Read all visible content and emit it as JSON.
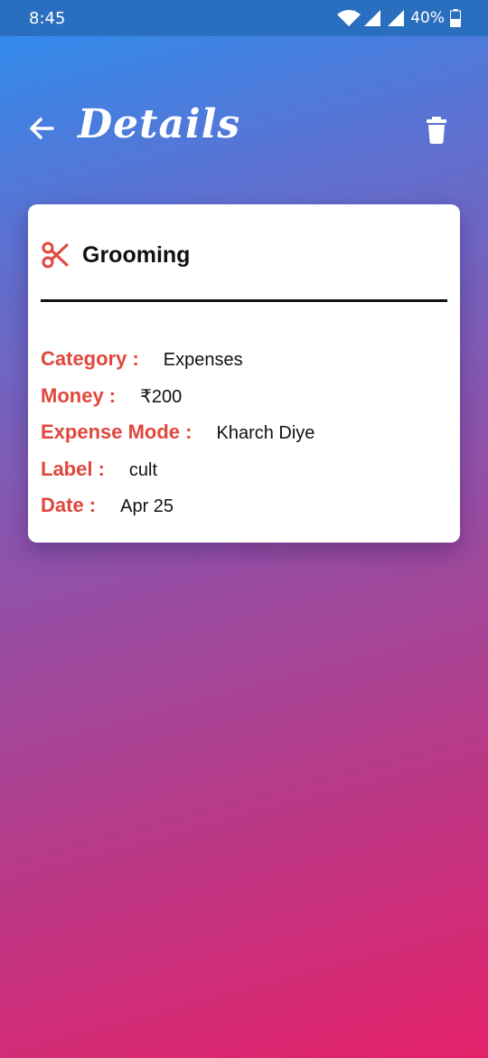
{
  "status_bar": {
    "time": "8:45",
    "battery_percent": "40%",
    "icons": [
      "wifi-icon",
      "signal-icon",
      "signal-icon",
      "battery-icon"
    ]
  },
  "app_bar": {
    "title": "Details",
    "back_icon": "arrow-left-icon",
    "delete_icon": "trash-icon"
  },
  "card": {
    "icon": "scissors-icon",
    "title": "Grooming",
    "fields": [
      {
        "label": "Category :",
        "value": "Expenses"
      },
      {
        "label": "Money :",
        "value": "₹200"
      },
      {
        "label": "Expense Mode :",
        "value": "Kharch Diye"
      },
      {
        "label": "Label :",
        "value": "cult"
      },
      {
        "label": "Date :",
        "value": "Apr 25"
      }
    ]
  },
  "colors": {
    "label_red": "#e0473c",
    "gradient_top": "#2b8ff0",
    "gradient_bottom": "#e4216a"
  }
}
